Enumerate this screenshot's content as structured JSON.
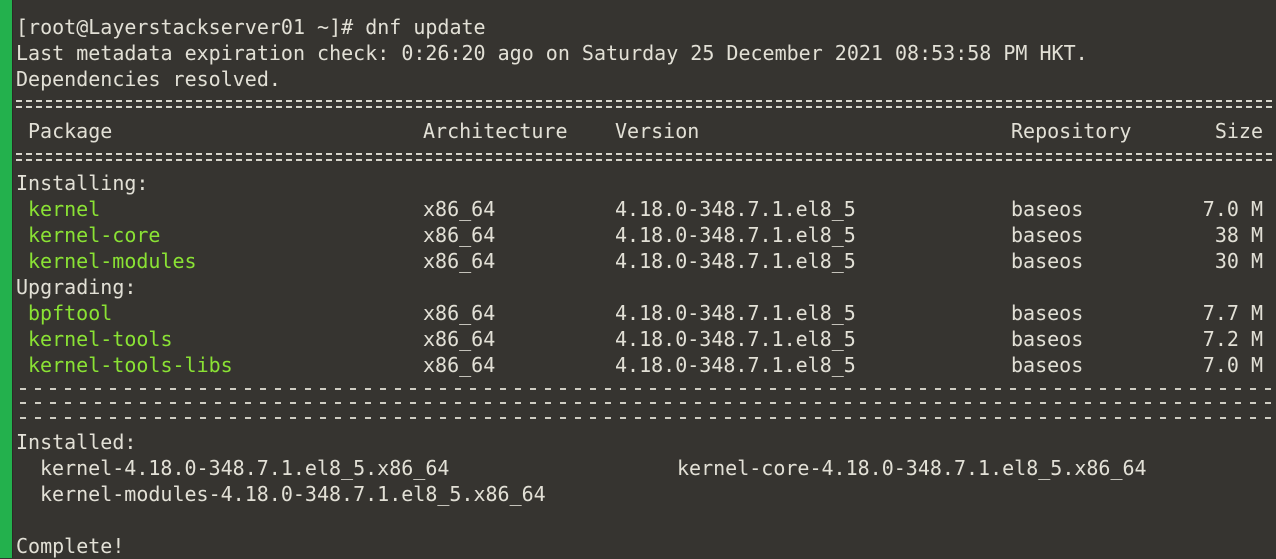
{
  "terminal": {
    "prompt_line": "[root@Layerstackserver01 ~]# dnf update",
    "metadata_line": "Last metadata expiration check: 0:26:20 ago on Saturday 25 December 2021 08:53:58 PM HKT.",
    "deps_line": "Dependencies resolved.",
    "headers": {
      "package": "Package",
      "arch": "Architecture",
      "version": "Version",
      "repo": "Repository",
      "size": "Size"
    },
    "installing_label": "Installing:",
    "installing": [
      {
        "package": "kernel",
        "arch": "x86_64",
        "version": "4.18.0-348.7.1.el8_5",
        "repo": "baseos",
        "size": "7.0 M"
      },
      {
        "package": "kernel-core",
        "arch": "x86_64",
        "version": "4.18.0-348.7.1.el8_5",
        "repo": "baseos",
        "size": "38 M"
      },
      {
        "package": "kernel-modules",
        "arch": "x86_64",
        "version": "4.18.0-348.7.1.el8_5",
        "repo": "baseos",
        "size": "30 M"
      }
    ],
    "upgrading_label": "Upgrading:",
    "upgrading": [
      {
        "package": "bpftool",
        "arch": "x86_64",
        "version": "4.18.0-348.7.1.el8_5",
        "repo": "baseos",
        "size": "7.7 M"
      },
      {
        "package": "kernel-tools",
        "arch": "x86_64",
        "version": "4.18.0-348.7.1.el8_5",
        "repo": "baseos",
        "size": "7.2 M"
      },
      {
        "package": "kernel-tools-libs",
        "arch": "x86_64",
        "version": "4.18.0-348.7.1.el8_5",
        "repo": "baseos",
        "size": "7.0 M"
      }
    ],
    "installed_label": "Installed:",
    "installed": [
      "kernel-4.18.0-348.7.1.el8_5.x86_64",
      "kernel-core-4.18.0-348.7.1.el8_5.x86_64",
      "kernel-modules-4.18.0-348.7.1.el8_5.x86_64"
    ],
    "complete": "Complete!",
    "colors": {
      "background": "#363430",
      "text": "#e2e0d6",
      "package_name": "#8ae234",
      "window_edge": "#23b14d"
    }
  }
}
